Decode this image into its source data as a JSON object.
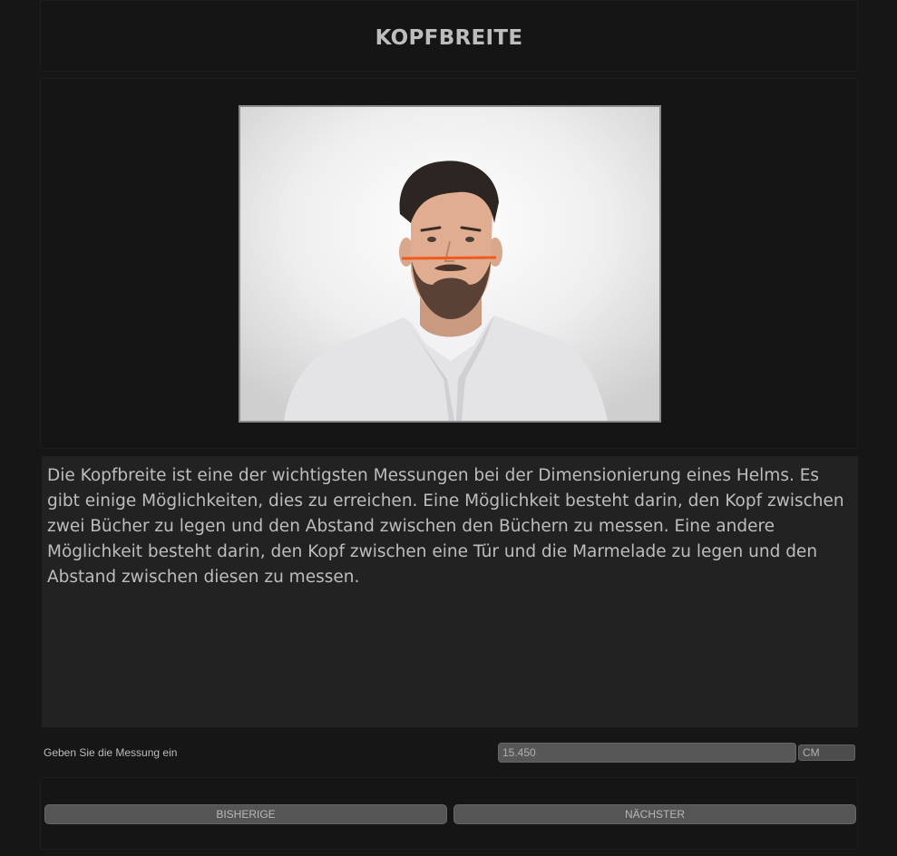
{
  "header": {
    "title": "KOPFBREITE"
  },
  "instructions": {
    "text": "Die Kopfbreite ist eine der wichtigsten Messungen bei der Dimensionierung eines Helms. Es gibt einige Möglichkeiten, dies zu erreichen. Eine Möglichkeit besteht darin, den Kopf zwischen zwei Bücher zu legen und den Abstand zwischen den Büchern zu messen. Eine andere Möglichkeit besteht darin, den Kopf zwischen eine Tür und die Marmelade zu legen und den Abstand zwischen diesen zu messen."
  },
  "measurement": {
    "label": "Geben Sie die Messung ein",
    "value": "15.450",
    "unit": "CM"
  },
  "navigation": {
    "previous_label": "BISHERIGE",
    "next_label": "NÄCHSTER"
  },
  "colors": {
    "measure_line": "#f05a1e",
    "background": "#161616"
  }
}
